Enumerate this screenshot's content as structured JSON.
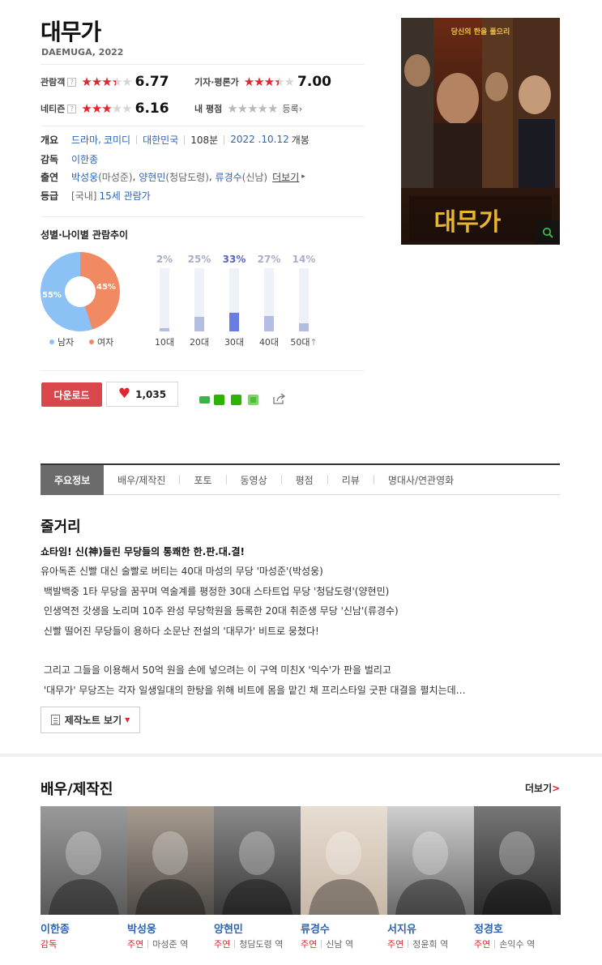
{
  "movie": {
    "title": "대무가",
    "subtitle": "DAEMUGA, 2022"
  },
  "ratings": {
    "audience": {
      "label": "관람객",
      "help": "?",
      "score": "6.77",
      "stars_fraction": 0.677
    },
    "critics": {
      "label": "기자·평론가",
      "score": "7.00",
      "stars_fraction": 0.7
    },
    "netizen": {
      "label": "네티즌",
      "help": "?",
      "score": "6.16",
      "stars_fraction": 0.616
    },
    "mine": {
      "label": "내 평점",
      "link": "등록",
      "link_arrow": "›",
      "stars_fraction": 0
    }
  },
  "stars_glyph": "★★★★★",
  "info": {
    "summary_key": "개요",
    "genre_1": "드라마",
    "genre_comma": ",",
    "genre_2": "코미디",
    "country": "대한민국",
    "runtime": "108분",
    "release_date": "2022 .10.12",
    "release_suffix": "개봉",
    "director_key": "감독",
    "director": "이한종",
    "cast_key": "출연",
    "cast": [
      {
        "name": "박성웅",
        "role": "(마성준)"
      },
      {
        "name": "양현민",
        "role": "(청담도령)"
      },
      {
        "name": "류경수",
        "role": "(신남)"
      }
    ],
    "cast_more": "더보기",
    "cast_more_arrow": "▸",
    "rating_key": "등급",
    "rating_region": "[국내]",
    "rating_value": "15세 관람가"
  },
  "demographics": {
    "title": "성별·나이별 관람추이",
    "gender": {
      "male_pct": 55,
      "female_pct": 45,
      "male_label": "55%",
      "female_label": "45%",
      "male_legend": "남자",
      "female_legend": "여자",
      "male_color": "#8bc1f5",
      "female_color": "#f18a63"
    },
    "ages": [
      {
        "pct_label": "2%",
        "value": 2,
        "age": "10대",
        "highlight": false
      },
      {
        "pct_label": "25%",
        "value": 25,
        "age": "20대",
        "highlight": false
      },
      {
        "pct_label": "33%",
        "value": 33,
        "age": "30대",
        "highlight": true
      },
      {
        "pct_label": "27%",
        "value": 27,
        "age": "40대",
        "highlight": false
      },
      {
        "pct_label": "14%",
        "value": 14,
        "age": "50대",
        "age_suffix": "↑",
        "highlight": false
      }
    ]
  },
  "actions": {
    "download": "다운로드",
    "like_count": "1,035"
  },
  "tabs": [
    "주요정보",
    "배우/제작진",
    "포토",
    "동영상",
    "평점",
    "리뷰",
    "명대사/연관영화"
  ],
  "synopsis": {
    "title": "줄거리",
    "headline": "쇼타임! 신(神)들린 무당들의 통쾌한 한.판.대.결!",
    "lines": [
      "유아독존 신빨 대신 술빨로 버티는 40대 마성의 무당 '마성준'(박성웅)",
      " 백발백중 1타 무당을 꿈꾸며 역술계를 평정한 30대 스타트업 무당 '청담도령'(양현민)",
      " 인생역전 갓생을 노리며 10주 완성 무당학원을 등록한 20대 취준생 무당 '신남'(류경수)",
      " 신빨 떨어진 무당들이 용하다 소문난 전설의 '대무가' 비트로 뭉쳤다!",
      "",
      " 그리고 그들을 이용해서 50억 원을 손에 넣으려는 이 구역 미친X '익수'가 판을 벌리고",
      " '대무가' 무당즈는 각자 일생일대의 한탕을 위해 비트에 몸을 맡긴 채 프리스타일 굿판 대결을 펼치는데…"
    ],
    "note_button": "제작노트 보기"
  },
  "cast_section": {
    "title": "배우/제작진",
    "more": "더보기",
    "more_arrow": ">",
    "people": [
      {
        "name": "이한종",
        "kind": "감독",
        "role": ""
      },
      {
        "name": "박성웅",
        "kind": "주연",
        "role": "마성준 역"
      },
      {
        "name": "양현민",
        "kind": "주연",
        "role": "청담도령 역"
      },
      {
        "name": "류경수",
        "kind": "주연",
        "role": "신남 역"
      },
      {
        "name": "서지유",
        "kind": "주연",
        "role": "정윤희 역"
      },
      {
        "name": "정경호",
        "kind": "주연",
        "role": "손익수 역"
      }
    ]
  },
  "poster": {
    "tagline": "당신의 한을 풀으리",
    "title": "대무가"
  }
}
